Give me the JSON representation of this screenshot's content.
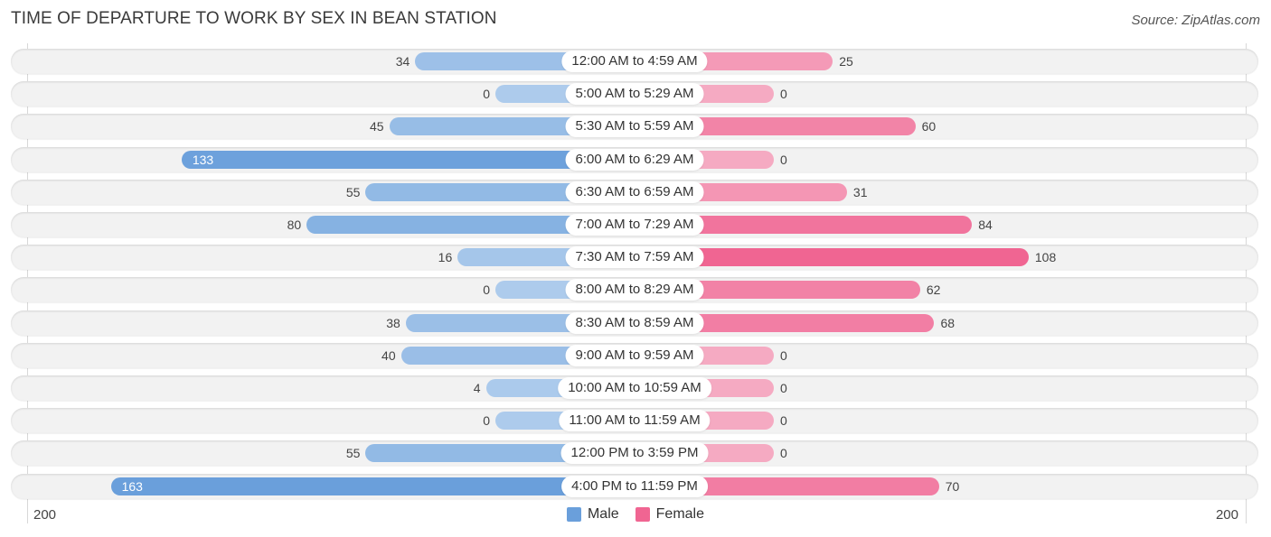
{
  "header": {
    "title": "TIME OF DEPARTURE TO WORK BY SEX IN BEAN STATION",
    "source": "Source: ZipAtlas.com"
  },
  "legend": {
    "male_label": "Male",
    "female_label": "Female"
  },
  "colors": {
    "male_dark": "#6a9fdb",
    "male_light": "#adcbec",
    "female_dark": "#f06592",
    "female_light": "#f5aac2"
  },
  "axis": {
    "left_tick": "200",
    "right_tick": "200"
  },
  "chart_data": {
    "type": "bar",
    "orientation": "horizontal-diverging",
    "title": "TIME OF DEPARTURE TO WORK BY SEX IN BEAN STATION",
    "categories": [
      "12:00 AM to 4:59 AM",
      "5:00 AM to 5:29 AM",
      "5:30 AM to 5:59 AM",
      "6:00 AM to 6:29 AM",
      "6:30 AM to 6:59 AM",
      "7:00 AM to 7:29 AM",
      "7:30 AM to 7:59 AM",
      "8:00 AM to 8:29 AM",
      "8:30 AM to 8:59 AM",
      "9:00 AM to 9:59 AM",
      "10:00 AM to 10:59 AM",
      "11:00 AM to 11:59 AM",
      "12:00 PM to 3:59 PM",
      "4:00 PM to 11:59 PM"
    ],
    "series": [
      {
        "name": "Male",
        "values": [
          34,
          0,
          45,
          133,
          55,
          80,
          16,
          0,
          38,
          40,
          4,
          0,
          55,
          163
        ]
      },
      {
        "name": "Female",
        "values": [
          25,
          0,
          60,
          0,
          31,
          84,
          108,
          62,
          68,
          0,
          0,
          0,
          0,
          70
        ]
      }
    ],
    "xlim": [
      -200,
      200
    ],
    "x_tick_labels": [
      "200",
      "200"
    ],
    "legend_position": "bottom-center",
    "grid": false
  }
}
